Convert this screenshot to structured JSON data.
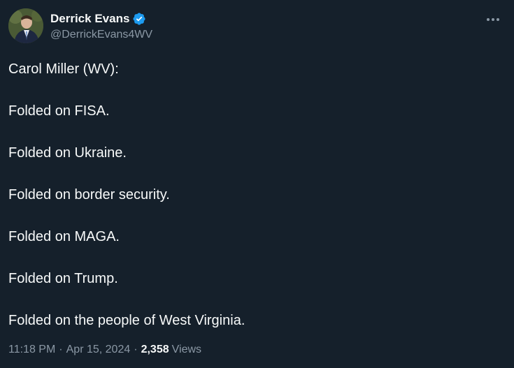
{
  "author": {
    "display_name": "Derrick Evans",
    "handle": "@DerrickEvans4WV",
    "verified": true
  },
  "tweet": {
    "lines": [
      "Carol Miller (WV):",
      "Folded on FISA.",
      "Folded on Ukraine.",
      "Folded on border security.",
      "Folded on MAGA.",
      "Folded on Trump.",
      "Folded on the people of West Virginia."
    ]
  },
  "meta": {
    "time": "11:18 PM",
    "separator": "·",
    "date": "Apr 15, 2024",
    "views_count": "2,358",
    "views_label": "Views"
  },
  "icons": {
    "verified": "verified-badge-icon",
    "more": "more-options-icon"
  },
  "colors": {
    "background": "#15202b",
    "text_primary": "#f7f9f9",
    "text_secondary": "#8b98a5",
    "verified_blue": "#1d9bf0"
  }
}
